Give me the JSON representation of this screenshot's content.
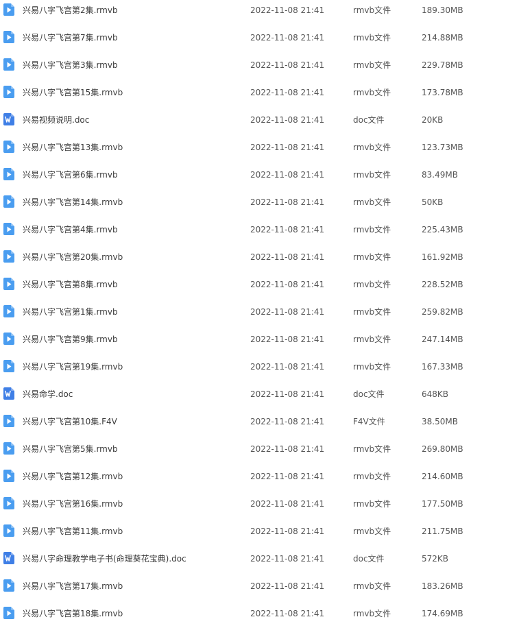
{
  "colors": {
    "video_icon": "#4a9df0",
    "doc_icon": "#3f7fe6",
    "text": "#3b3b3b"
  },
  "files": [
    {
      "name": "兴易八字飞宫第2集.rmvb",
      "time": "2022-11-08 21:41",
      "type": "rmvb文件",
      "size": "189.30MB",
      "icon": "video-file-icon"
    },
    {
      "name": "兴易八字飞宫第7集.rmvb",
      "time": "2022-11-08 21:41",
      "type": "rmvb文件",
      "size": "214.88MB",
      "icon": "video-file-icon"
    },
    {
      "name": "兴易八字飞宫第3集.rmvb",
      "time": "2022-11-08 21:41",
      "type": "rmvb文件",
      "size": "229.78MB",
      "icon": "video-file-icon"
    },
    {
      "name": "兴易八字飞宫第15集.rmvb",
      "time": "2022-11-08 21:41",
      "type": "rmvb文件",
      "size": "173.78MB",
      "icon": "video-file-icon"
    },
    {
      "name": "兴易视频说明.doc",
      "time": "2022-11-08 21:41",
      "type": "doc文件",
      "size": "20KB",
      "icon": "word-doc-icon"
    },
    {
      "name": "兴易八字飞宫第13集.rmvb",
      "time": "2022-11-08 21:41",
      "type": "rmvb文件",
      "size": "123.73MB",
      "icon": "video-file-icon"
    },
    {
      "name": "兴易八字飞宫第6集.rmvb",
      "time": "2022-11-08 21:41",
      "type": "rmvb文件",
      "size": "83.49MB",
      "icon": "video-file-icon"
    },
    {
      "name": "兴易八字飞宫第14集.rmvb",
      "time": "2022-11-08 21:41",
      "type": "rmvb文件",
      "size": "50KB",
      "icon": "video-file-icon"
    },
    {
      "name": "兴易八字飞宫第4集.rmvb",
      "time": "2022-11-08 21:41",
      "type": "rmvb文件",
      "size": "225.43MB",
      "icon": "video-file-icon"
    },
    {
      "name": "兴易八字飞宫第20集.rmvb",
      "time": "2022-11-08 21:41",
      "type": "rmvb文件",
      "size": "161.92MB",
      "icon": "video-file-icon"
    },
    {
      "name": "兴易八字飞宫第8集.rmvb",
      "time": "2022-11-08 21:41",
      "type": "rmvb文件",
      "size": "228.52MB",
      "icon": "video-file-icon"
    },
    {
      "name": "兴易八字飞宫第1集.rmvb",
      "time": "2022-11-08 21:41",
      "type": "rmvb文件",
      "size": "259.82MB",
      "icon": "video-file-icon"
    },
    {
      "name": "兴易八字飞宫第9集.rmvb",
      "time": "2022-11-08 21:41",
      "type": "rmvb文件",
      "size": "247.14MB",
      "icon": "video-file-icon"
    },
    {
      "name": "兴易八字飞宫第19集.rmvb",
      "time": "2022-11-08 21:41",
      "type": "rmvb文件",
      "size": "167.33MB",
      "icon": "video-file-icon"
    },
    {
      "name": "兴易命学.doc",
      "time": "2022-11-08 21:41",
      "type": "doc文件",
      "size": "648KB",
      "icon": "word-doc-icon"
    },
    {
      "name": "兴易八字飞宫第10集.F4V",
      "time": "2022-11-08 21:41",
      "type": "F4V文件",
      "size": "38.50MB",
      "icon": "video-file-icon"
    },
    {
      "name": "兴易八字飞宫第5集.rmvb",
      "time": "2022-11-08 21:41",
      "type": "rmvb文件",
      "size": "269.80MB",
      "icon": "video-file-icon"
    },
    {
      "name": "兴易八字飞宫第12集.rmvb",
      "time": "2022-11-08 21:41",
      "type": "rmvb文件",
      "size": "214.60MB",
      "icon": "video-file-icon"
    },
    {
      "name": "兴易八字飞宫第16集.rmvb",
      "time": "2022-11-08 21:41",
      "type": "rmvb文件",
      "size": "177.50MB",
      "icon": "video-file-icon"
    },
    {
      "name": "兴易八字飞宫第11集.rmvb",
      "time": "2022-11-08 21:41",
      "type": "rmvb文件",
      "size": "211.75MB",
      "icon": "video-file-icon"
    },
    {
      "name": "兴易八字命理教学电子书(命理葵花宝典).doc",
      "time": "2022-11-08 21:41",
      "type": "doc文件",
      "size": "572KB",
      "icon": "word-doc-icon"
    },
    {
      "name": "兴易八字飞宫第17集.rmvb",
      "time": "2022-11-08 21:41",
      "type": "rmvb文件",
      "size": "183.26MB",
      "icon": "video-file-icon"
    },
    {
      "name": "兴易八字飞宫第18集.rmvb",
      "time": "2022-11-08 21:41",
      "type": "rmvb文件",
      "size": "174.69MB",
      "icon": "video-file-icon"
    }
  ]
}
